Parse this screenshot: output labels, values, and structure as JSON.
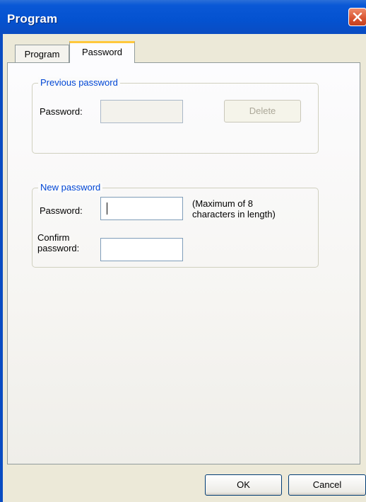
{
  "window": {
    "title": "Program"
  },
  "tabs": [
    {
      "label": "Program",
      "selected": false
    },
    {
      "label": "Password",
      "selected": true
    }
  ],
  "previous_password": {
    "legend": "Previous password",
    "password_label": "Password:",
    "password_value": "",
    "delete_label": "Delete"
  },
  "new_password": {
    "legend": "New password",
    "password_label": "Password:",
    "password_value": "",
    "hint_line1": "(Maximum of 8",
    "hint_line2": "characters in length)",
    "confirm_label_line1": "Confirm",
    "confirm_label_line2": "password:",
    "confirm_value": ""
  },
  "buttons": {
    "ok": "OK",
    "cancel": "Cancel"
  },
  "colors": {
    "titlebar": "#0452d0",
    "accent_text": "#0046d5",
    "tab_highlight": "#ffc83c",
    "close_button": "#d8532f"
  }
}
